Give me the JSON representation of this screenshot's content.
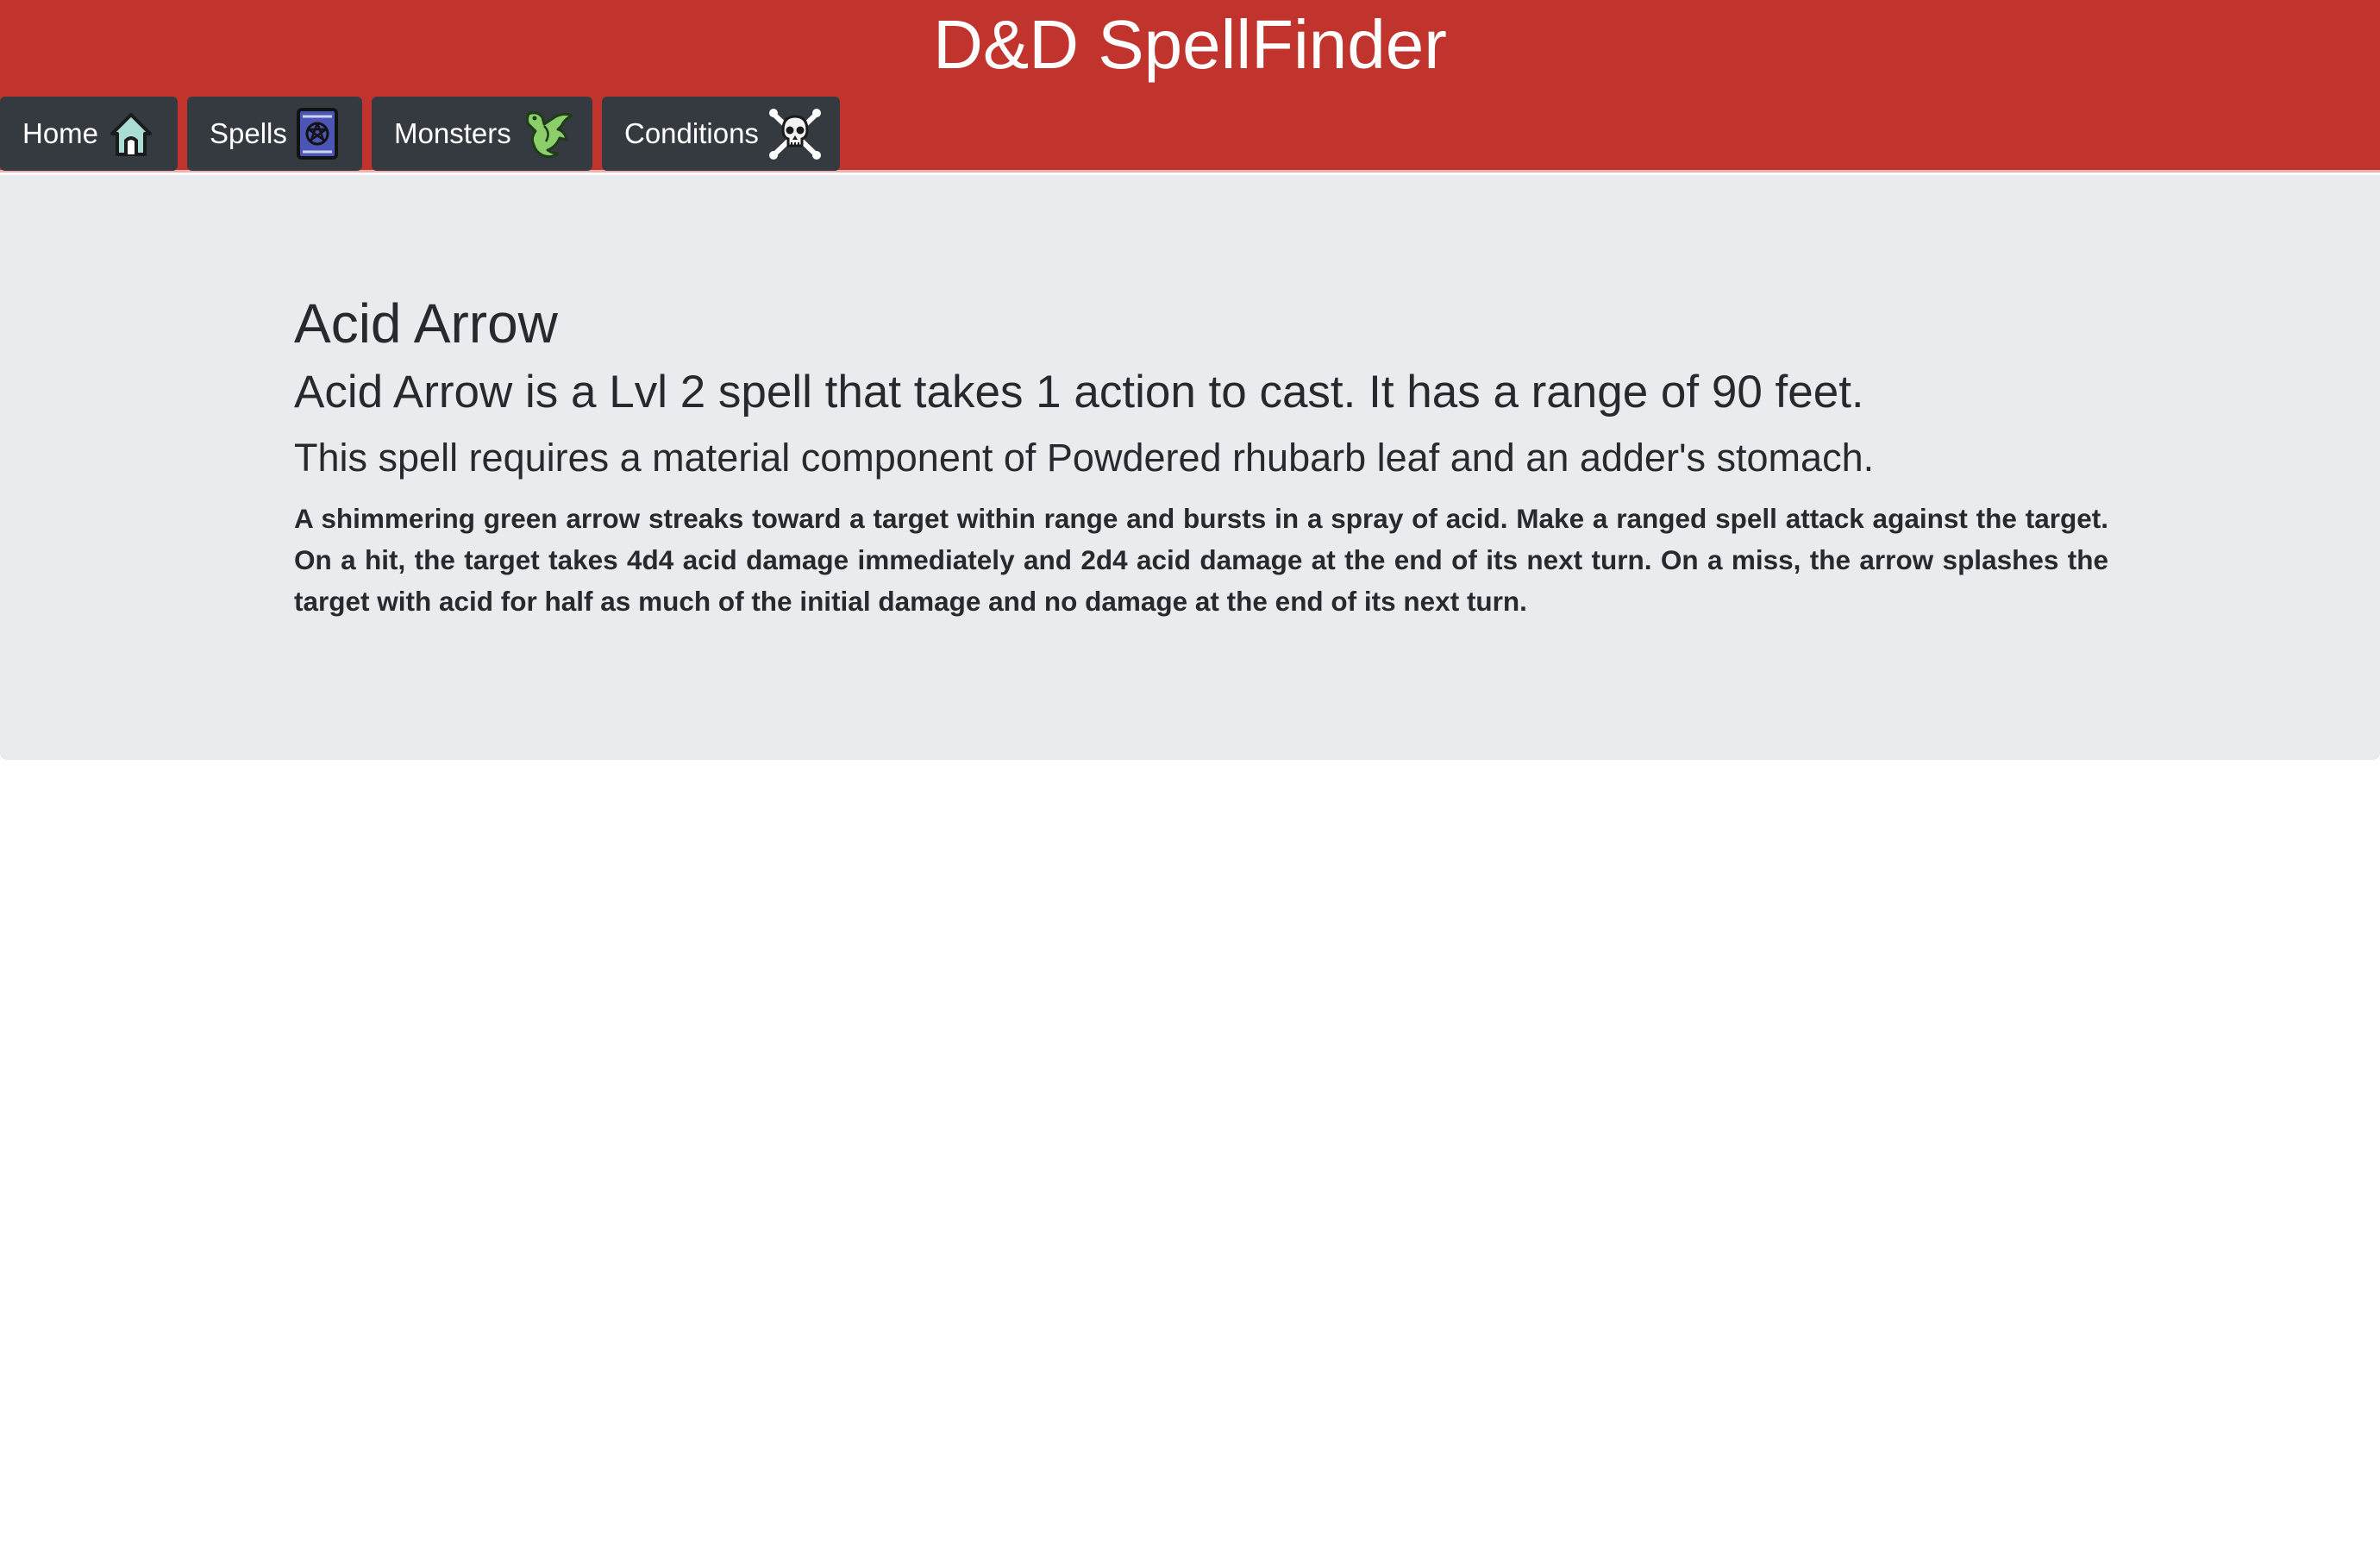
{
  "header": {
    "title": "D&D SpellFinder",
    "background_color": "#c0342d"
  },
  "nav": {
    "items": [
      {
        "label": "Home",
        "icon": "house-icon"
      },
      {
        "label": "Spells",
        "icon": "spellbook-icon"
      },
      {
        "label": "Monsters",
        "icon": "dragon-icon"
      },
      {
        "label": "Conditions",
        "icon": "skull-crossbones-icon"
      }
    ]
  },
  "spell": {
    "name": "Acid Arrow",
    "summary": "Acid Arrow is a Lvl 2 spell that takes 1 action to cast. It has a range of 90 feet.",
    "material": "This spell requires a material component of Powdered rhubarb leaf and an adder's stomach.",
    "description": "A shimmering green arrow streaks toward a target within range and bursts in a spray of acid. Make a ranged spell attack against the target. On a hit, the target takes 4d4 acid damage immediately and 2d4 acid damage at the end of its next turn. On a miss, the arrow splashes the target with acid for half as much of the initial damage and no damage at the end of its next turn."
  }
}
